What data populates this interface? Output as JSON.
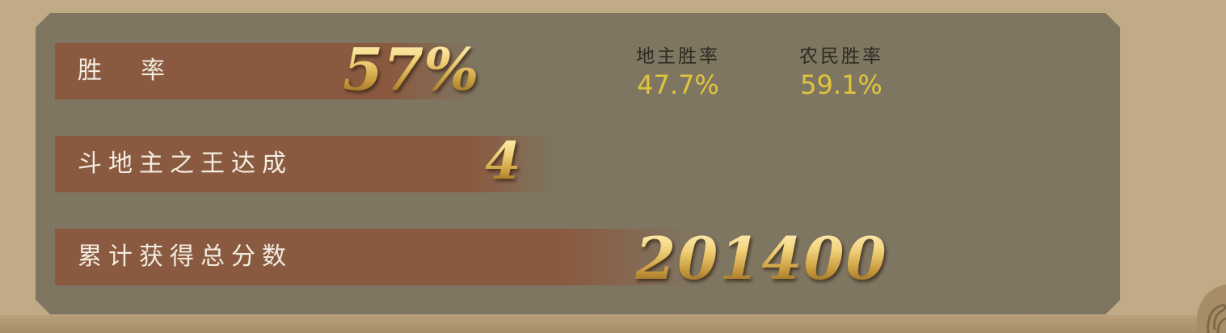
{
  "stats": {
    "win_rate": {
      "label": "胜率",
      "value": "57%"
    },
    "king_achieved": {
      "label": "斗地主之王达成",
      "value": "4"
    },
    "total_score": {
      "label": "累计获得总分数",
      "value": "201400"
    }
  },
  "sub_stats": {
    "landlord": {
      "label": "地主胜率",
      "value": "47.7%"
    },
    "farmer": {
      "label": "农民胜率",
      "value": "59.1%"
    }
  },
  "colors": {
    "panel": "#7f7662",
    "bar": "#8a5a40",
    "frame": "#c0ab86",
    "sub_value": "#e0c53c",
    "big_number_gold": "#e8c868"
  }
}
